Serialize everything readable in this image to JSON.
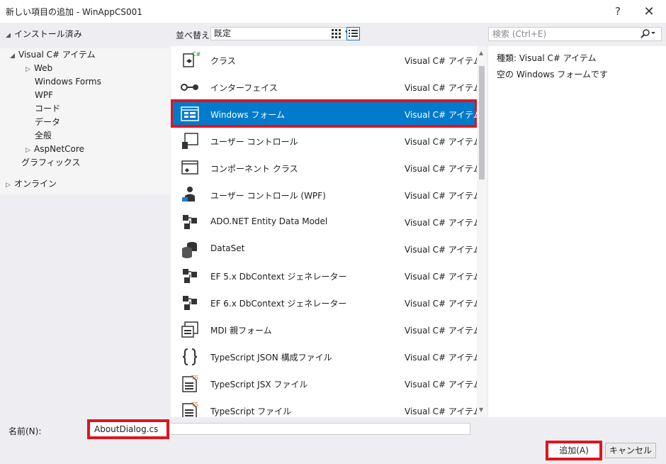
{
  "window": {
    "title": "新しい項目の追加 - WinAppCS001",
    "help": "?",
    "close": "✕"
  },
  "left": {
    "installed": "インストール済み",
    "tree": [
      {
        "label": "Visual C# アイテム"
      },
      {
        "label": "Web"
      },
      {
        "label": "Windows Forms"
      },
      {
        "label": "WPF"
      },
      {
        "label": "コード"
      },
      {
        "label": "データ"
      },
      {
        "label": "全般"
      },
      {
        "label": "AspNetCore"
      },
      {
        "label": "グラフィックス"
      }
    ],
    "online": "オンライン"
  },
  "toolbar": {
    "sort_label": "並べ替え:",
    "sort_value": "既定"
  },
  "search": {
    "placeholder": "検索 (Ctrl+E)"
  },
  "items": [
    {
      "name": "クラス",
      "type": "Visual C# アイテム",
      "icon": "class-icon"
    },
    {
      "name": "インターフェイス",
      "type": "Visual C# アイテム",
      "icon": "interface-icon"
    },
    {
      "name": "Windows フォーム",
      "type": "Visual C# アイテム",
      "icon": "windows-form-icon"
    },
    {
      "name": "ユーザー コントロール",
      "type": "Visual C# アイテム",
      "icon": "user-control-icon"
    },
    {
      "name": "コンポーネント クラス",
      "type": "Visual C# アイテム",
      "icon": "component-class-icon"
    },
    {
      "name": "ユーザー コントロール (WPF)",
      "type": "Visual C# アイテム",
      "icon": "wpf-user-control-icon"
    },
    {
      "name": "ADO.NET Entity Data Model",
      "type": "Visual C# アイテム",
      "icon": "entity-model-icon"
    },
    {
      "name": "DataSet",
      "type": "Visual C# アイテム",
      "icon": "dataset-icon"
    },
    {
      "name": "EF 5.x DbContext ジェネレーター",
      "type": "Visual C# アイテム",
      "icon": "ef-generator-icon"
    },
    {
      "name": "EF 6.x DbContext ジェネレーター",
      "type": "Visual C# アイテム",
      "icon": "ef-generator-icon"
    },
    {
      "name": "MDI 親フォーム",
      "type": "Visual C# アイテム",
      "icon": "mdi-form-icon"
    },
    {
      "name": "TypeScript JSON 構成ファイル",
      "type": "Visual C# アイテム",
      "icon": "json-config-icon"
    },
    {
      "name": "TypeScript JSX ファイル",
      "type": "Visual C# アイテム",
      "icon": "ts-file-icon"
    },
    {
      "name": "TypeScript ファイル",
      "type": "Visual C# アイテム",
      "icon": "ts-file-icon"
    }
  ],
  "details": {
    "kind": "種類: Visual C# アイテム",
    "description": "空の Windows フォームです"
  },
  "bottom": {
    "name_label": "名前(N):",
    "name_value": "AboutDialog.cs",
    "add_label": "追加(A)",
    "cancel_label": "キャンセル"
  }
}
